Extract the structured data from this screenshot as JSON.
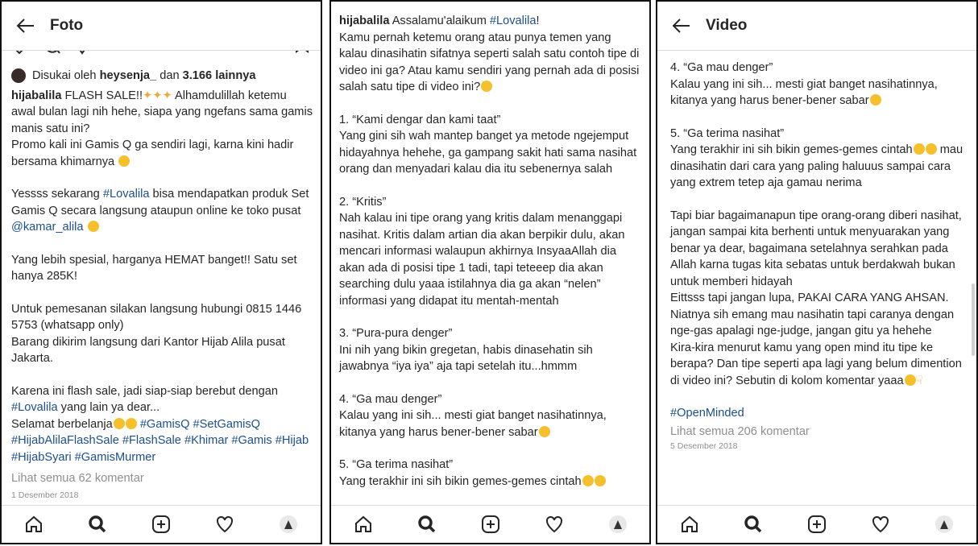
{
  "panel1": {
    "title": "Foto",
    "likes_prefix": "Disukai oleh ",
    "likes_user": "heysenja_",
    "likes_mid": " dan ",
    "likes_count": "3.166 lainnya",
    "caption_user": "hijabalila",
    "caption_line1": " FLASH SALE!!",
    "caption_line1b": " Alhamdulillah ketemu awal bulan lagi nih hehe, siapa yang ngefans sama gamis manis satu ini?",
    "caption_line2": "Promo kali ini Gamis Q ga sendiri lagi, karna kini hadir bersama khimarnya",
    "para2_a": "Yessss sekarang ",
    "para2_tag": "#Lovalila",
    "para2_b": " bisa mendapatkan produk Set Gamis Q secara langsung ataupun online ke toko pusat ",
    "para2_mention": "@kamar_alila",
    "para3": "Yang lebih spesial, harganya HEMAT banget!! Satu set hanya 285K!",
    "para4_a": "Untuk pemesanan silakan langsung hubungi 0815 1446 5753 (whatsapp only)",
    "para4_b": "Barang dikirim langsung dari Kantor Hijab Alila pusat Jakarta.",
    "para5_a": "Karena ini flash sale, jadi siap-siap berebut dengan ",
    "para5_tag": "#Lovalila",
    "para5_b": " yang lain ya dear...",
    "para5_c": "Selamat berbelanja",
    "hashtags": "#GamisQ #SetGamisQ #HijabAlilaFlashSale #FlashSale #Khimar #Gamis #Hijab #HijabSyari #GamisMurmer",
    "comments_link": "Lihat semua 62 komentar",
    "date": "1 Desember 2018"
  },
  "panel2": {
    "caption_user": "hijabalila",
    "caption_a": " Assalamu'alaikum ",
    "caption_tag": "#Lovalila",
    "caption_b": "!",
    "intro": "Kamu pernah ketemu orang atau punya temen yang kalau dinasihatin sifatnya seperti salah satu contoh tipe di video ini ga? Atau kamu sendiri yang pernah ada di posisi salah satu tipe di video ini?",
    "item1_title": "1. “Kami dengar dan kami taat”",
    "item1_body": "Yang gini sih wah mantep banget ya metode ngejemput hidayahnya hehehe, ga gampang sakit hati sama nasihat orang dan menyadari kalau dia itu sebenernya salah",
    "item2_title": "2. “Kritis”",
    "item2_body": "Nah kalau ini tipe orang yang kritis dalam menanggapi nasihat. Kritis dalam artian dia akan berpikir dulu, akan mencari informasi walaupun akhirnya InsyaaAllah dia akan ada di posisi tipe 1 tadi, tapi teteeep dia akan searching dulu yaaa istilahnya dia ga akan “nelen” informasi yang didapat itu mentah-mentah",
    "item3_title": "3. “Pura-pura denger”",
    "item3_body": "Ini nih yang bikin gregetan, habis dinasehatin sih jawabnya “iya iya” aja tapi setelah itu...hmmm",
    "item4_title": "4. “Ga mau denger”",
    "item4_body": "Kalau yang ini sih... mesti giat banget nasihatinnya, kitanya yang harus bener-bener sabar",
    "item5_title": "5. “Ga terima nasihat”",
    "item5_body": "Yang terakhir ini sih bikin gemes-gemes cintah"
  },
  "panel3": {
    "title": "Video",
    "item4_title": "4. “Ga mau denger”",
    "item4_body": "Kalau yang ini sih... mesti giat banget nasihatinnya, kitanya yang harus bener-bener sabar",
    "item5_title": "5. “Ga terima nasihat”",
    "item5_body_a": "Yang terakhir ini sih bikin gemes-gemes cintah",
    "item5_body_b": "mau dinasihatin dari cara yang paling haluuus sampai cara yang extrem tetep aja gamau nerima",
    "para_a": "Tapi biar bagaimanapun tipe orang-orang diberi nasihat, jangan sampai kita berhenti untuk menyuarakan yang benar ya dear, bagaimana setelahnya serahkan pada Allah karna tugas kita sebatas untuk berdakwah bukan untuk memberi hidayah",
    "para_b": "Eittsss tapi jangan lupa, PAKAI CARA YANG AHSAN. Niatnya sih emang mau nasihatin tapi caranya dengan nge-gas apalagi nge-judge, jangan gitu ya hehehe",
    "para_c": "Kira-kira menurut kamu yang open mind itu tipe ke berapa? Dan tipe seperti apa lagi yang belum dimention di video ini? Sebutin di kolom komentar yaaa",
    "hashtag": "#OpenMinded",
    "comments_link": "Lihat semua 206 komentar",
    "date": "5 Desember 2018"
  },
  "icons": [
    "back-arrow-icon",
    "home-icon",
    "search-icon",
    "add-post-icon",
    "heart-icon",
    "profile-avatar-icon",
    "comment-icon",
    "share-icon",
    "bookmark-icon"
  ],
  "colors": {
    "hashtag": "#1b4f8d",
    "muted": "#8e8e8e",
    "text": "#262626",
    "border": "#111111"
  }
}
